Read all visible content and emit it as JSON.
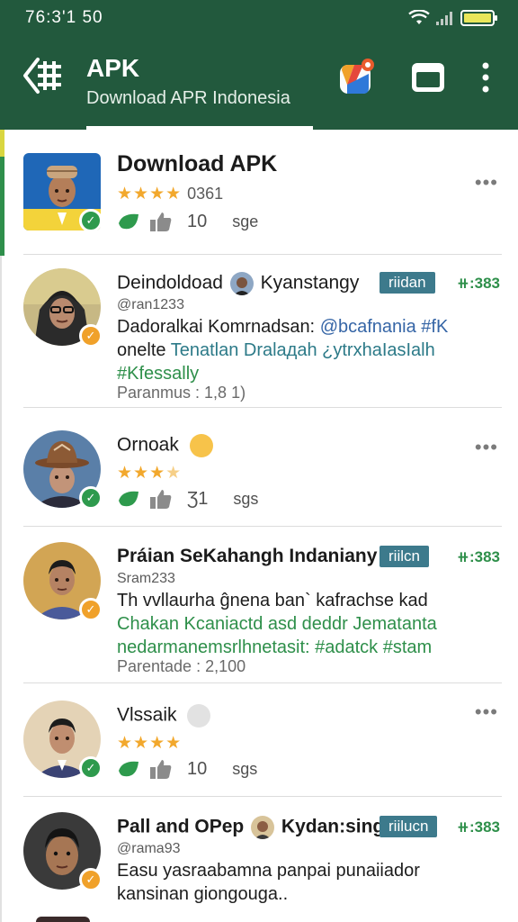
{
  "status": {
    "time": "76:3'1 50"
  },
  "appbar": {
    "title": "APK",
    "subtitle": "Download APR Indonesia"
  },
  "posts": [
    {
      "name": "Download APK",
      "rating_count": "0361",
      "stats_num": "10",
      "stats_unit": "sge"
    },
    {
      "name_a": "Deindoldoad",
      "name_b": "Kyanstangy",
      "tag": "riidan",
      "points": "⧺:383",
      "handle": "@ran1233",
      "text_plain": "Dadoralkai Komrnadsan:",
      "text_hl1": "@bcafnania #fK",
      "text_plain2": "onelte",
      "text_hl2": "Tenatlan Dralадah ¿ytrxhaIasIalh",
      "text_hl3": "#Kfessally",
      "meta": "Paranmus : 1,8 1)"
    },
    {
      "name": "Ornoak",
      "stats_num": "Ʒ1",
      "stats_unit": "sgs"
    },
    {
      "name": "Práian SeKahangh Indaniany",
      "tag": "riilcn",
      "points": "⧺:383",
      "handle": "Sram233",
      "text_plain": "Th vvllaurha ĝnena ban` kafrachse kad",
      "text_hl1": "Chakan Kcaniactd asd deddr Jematanta",
      "text_hl2": "nedarmanemsrlhnetasit:",
      "text_hl3": "#adatck #stam",
      "meta": "Parentade : 2,100"
    },
    {
      "name": "Vlssaik",
      "stats_num": "10",
      "stats_unit": "sgs"
    },
    {
      "name_a": "Pall and OPep",
      "name_b": "Kydan:sing:",
      "tag": "riilucn",
      "points": "⧺:383",
      "handle": "@rama93",
      "text_line1": "Easu yasraabamna panpai punaiiador",
      "text_line2": "kansinan giongouga.."
    }
  ]
}
